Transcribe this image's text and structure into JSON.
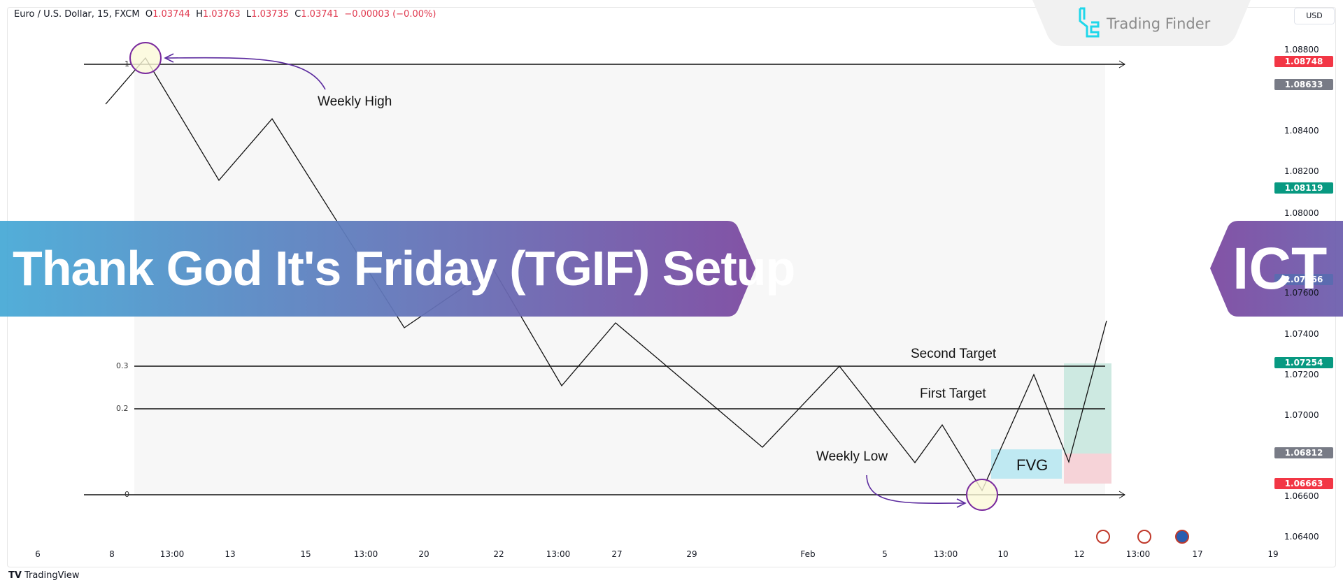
{
  "header": {
    "symbol": "Euro / U.S. Dollar, 15, FXCM",
    "o_label": "O",
    "o": "1.03744",
    "h_label": "H",
    "h": "1.03763",
    "l_label": "L",
    "l": "1.03735",
    "c_label": "C",
    "c": "1.03741",
    "change": "−0.00003 (−0.00%)"
  },
  "price_axis": {
    "currency": "USD",
    "ticks": [
      "1.08800",
      "1.08400",
      "1.08200",
      "1.08000",
      "1.07600",
      "1.07400",
      "1.07200",
      "1.07000",
      "1.06600",
      "1.06400"
    ],
    "badges": [
      {
        "value": "1.08748",
        "color": "#f23645"
      },
      {
        "value": "1.08633",
        "color": "#787b86"
      },
      {
        "value": "1.08119",
        "color": "#089981"
      },
      {
        "value": "1.07666",
        "color": "#5b6bb0"
      },
      {
        "value": "1.07254",
        "color": "#089981"
      },
      {
        "value": "1.06812",
        "color": "#787b86"
      },
      {
        "value": "1.06663",
        "color": "#f23645"
      }
    ]
  },
  "time_axis": [
    "6",
    "8",
    "13:00",
    "13",
    "15",
    "13:00",
    "20",
    "22",
    "13:00",
    "27",
    "29",
    "Feb",
    "5",
    "13:00",
    "10",
    "12",
    "13:00",
    "17",
    "19"
  ],
  "fib_levels": [
    "1",
    "0.3",
    "0.2",
    "0"
  ],
  "annotations": {
    "weekly_high": "Weekly High",
    "weekly_low": "Weekly Low",
    "second_target": "Second Target",
    "first_target": "First Target",
    "fvg": "FVG"
  },
  "banner": {
    "title": "Thank God It's Friday (TGIF)  Setup",
    "tag": "ICT",
    "gradient_start": "#47a9d6",
    "gradient_end": "#7b48a0"
  },
  "brand": {
    "logo_text": "Trading Finder",
    "footer": "TradingView"
  },
  "colors": {
    "fvg": "#bfe9f2",
    "target_zone": "#cde9e1",
    "stop_zone": "#f6d3d8",
    "annotation_arrow": "#5b2a9e"
  }
}
